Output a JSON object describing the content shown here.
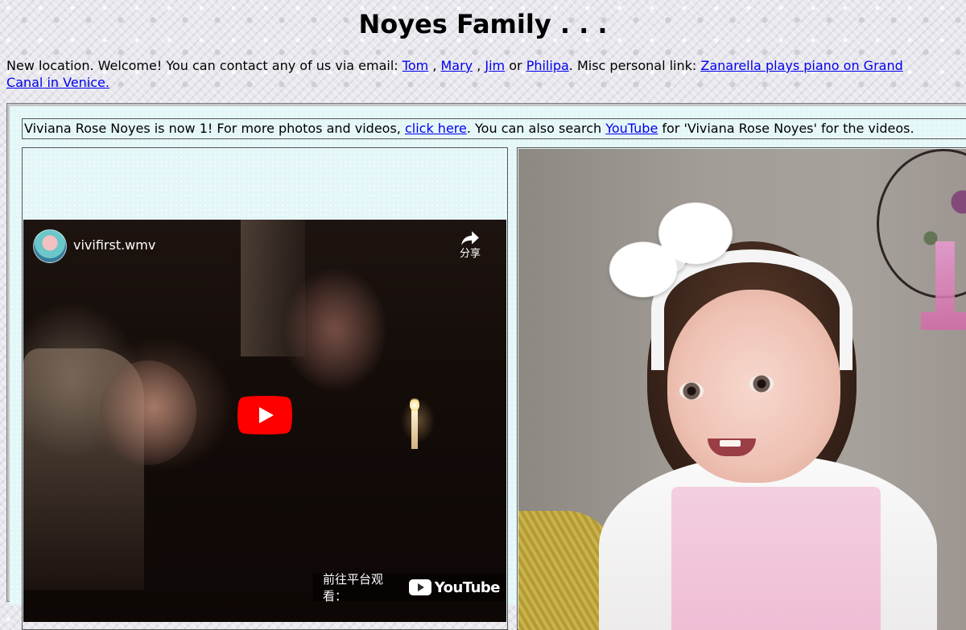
{
  "page": {
    "title": "Noyes Family . . .",
    "intro": {
      "text_before": "New location. Welcome! You can contact any of us via email: ",
      "links": [
        {
          "label": "Tom"
        },
        {
          "label": "Mary"
        },
        {
          "label": "Jim"
        },
        {
          "label": "Philipa"
        }
      ],
      "sep1": " , ",
      "sep2": " , ",
      "sep3": " or ",
      "text_after_links": ". Misc personal link: ",
      "misc_link_label": "Zanarella plays piano on Grand Canal in Venice."
    }
  },
  "announcement": {
    "text_before": "Viviana Rose Noyes is now 1! For more photos and videos, ",
    "click_here_label": "click here",
    "text_middle": ". You can also search ",
    "youtube_label": "YouTube",
    "text_after": " for 'Viviana Rose Noyes' for the videos."
  },
  "video": {
    "title": "vivifirst.wmv",
    "share_label": "分享",
    "watch_on_label": "前往平台观看：",
    "youtube_logo_label": "YouTube",
    "icons": {
      "channel": "channel-avatar-icon",
      "share": "share-arrow-icon",
      "play": "play-button-icon",
      "youtube": "youtube-logo-icon"
    }
  },
  "photo": {
    "subject": "baby-with-white-bow-photo"
  },
  "colors": {
    "link": "#0000ee",
    "inner_background": "#e3f6f8",
    "youtube_red": "#ff0000"
  }
}
